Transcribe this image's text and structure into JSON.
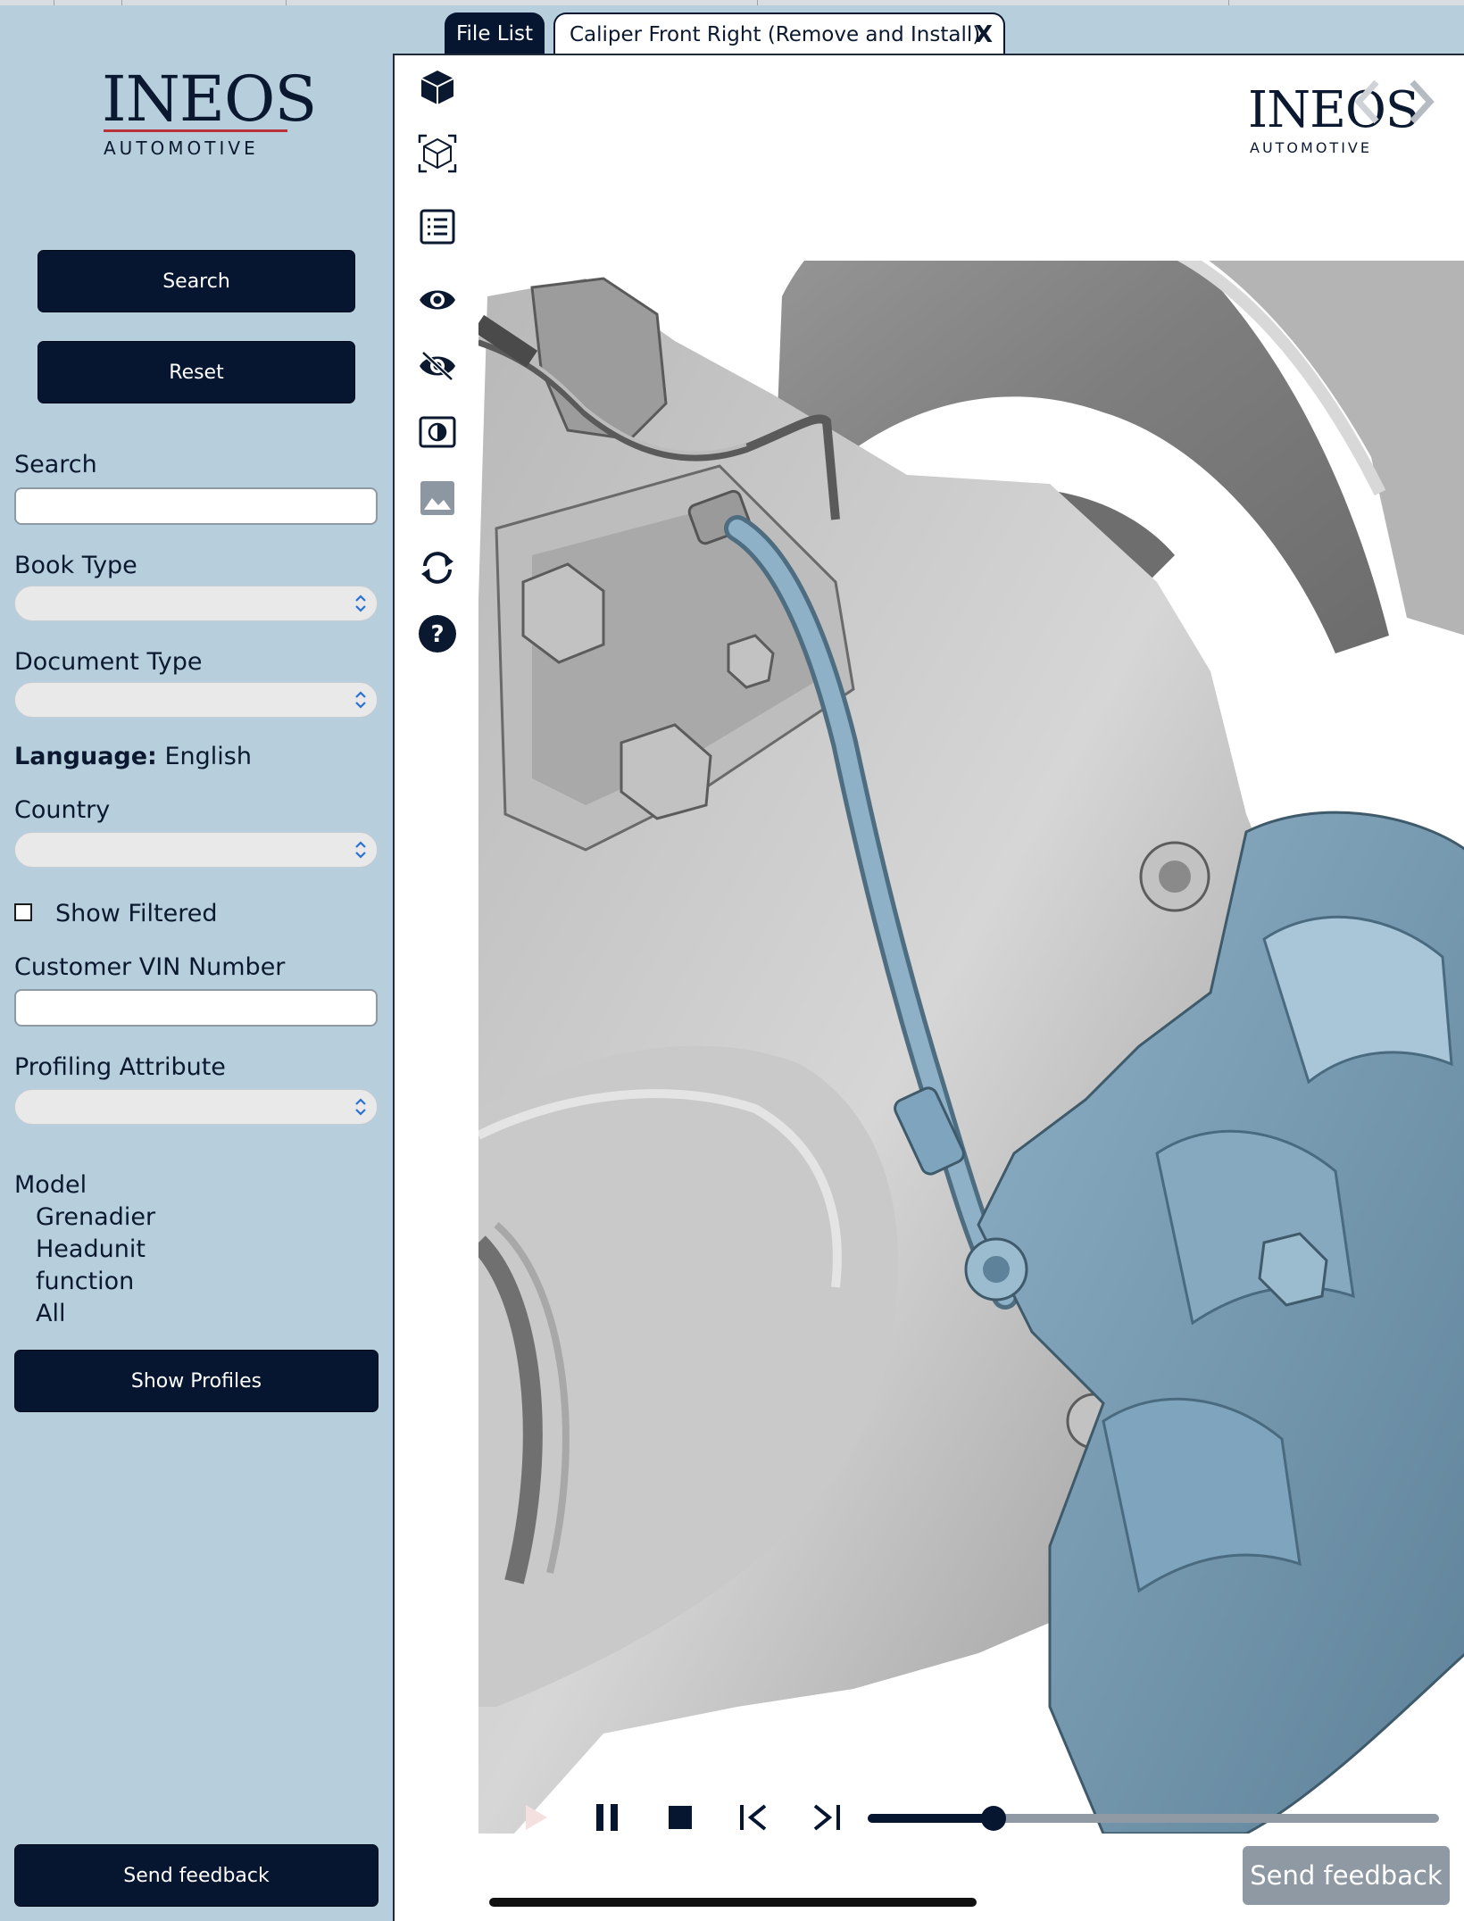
{
  "sidebar": {
    "logo": {
      "main": "INEOS",
      "sub": "AUTOMOTIVE"
    },
    "search_button": "Search",
    "reset_button": "Reset",
    "search_label": "Search",
    "search_value": "",
    "book_type_label": "Book Type",
    "document_type_label": "Document Type",
    "language_label": "Language:",
    "language_value": "English",
    "country_label": "Country",
    "show_filtered_label": "Show Filtered",
    "show_filtered_checked": false,
    "vin_label": "Customer VIN Number",
    "vin_value": "",
    "profiling_label": "Profiling Attribute",
    "model_label": "Model",
    "model_items": [
      "Grenadier",
      "Headunit",
      "function",
      "All"
    ],
    "show_profiles_button": "Show  Profiles",
    "send_feedback_button": "Send feedback"
  },
  "tabs": {
    "file_list": "File List",
    "active": "Caliper Front Right (Remove and Install)",
    "close": "X"
  },
  "viewer": {
    "logo": {
      "main": "INEOS",
      "sub": "AUTOMOTIVE"
    },
    "toolbar_icons": [
      "cube-icon",
      "wireframe-cube-icon",
      "list-icon",
      "eye-icon",
      "eye-off-icon",
      "contrast-icon",
      "image-icon",
      "refresh-icon",
      "help-icon"
    ],
    "playback_progress": 0.22,
    "send_feedback_button": "Send feedback",
    "colors": {
      "accent": "#061631",
      "highlight_part": "#7fa4bd",
      "sidebar_bg": "#b7cfdc"
    }
  }
}
